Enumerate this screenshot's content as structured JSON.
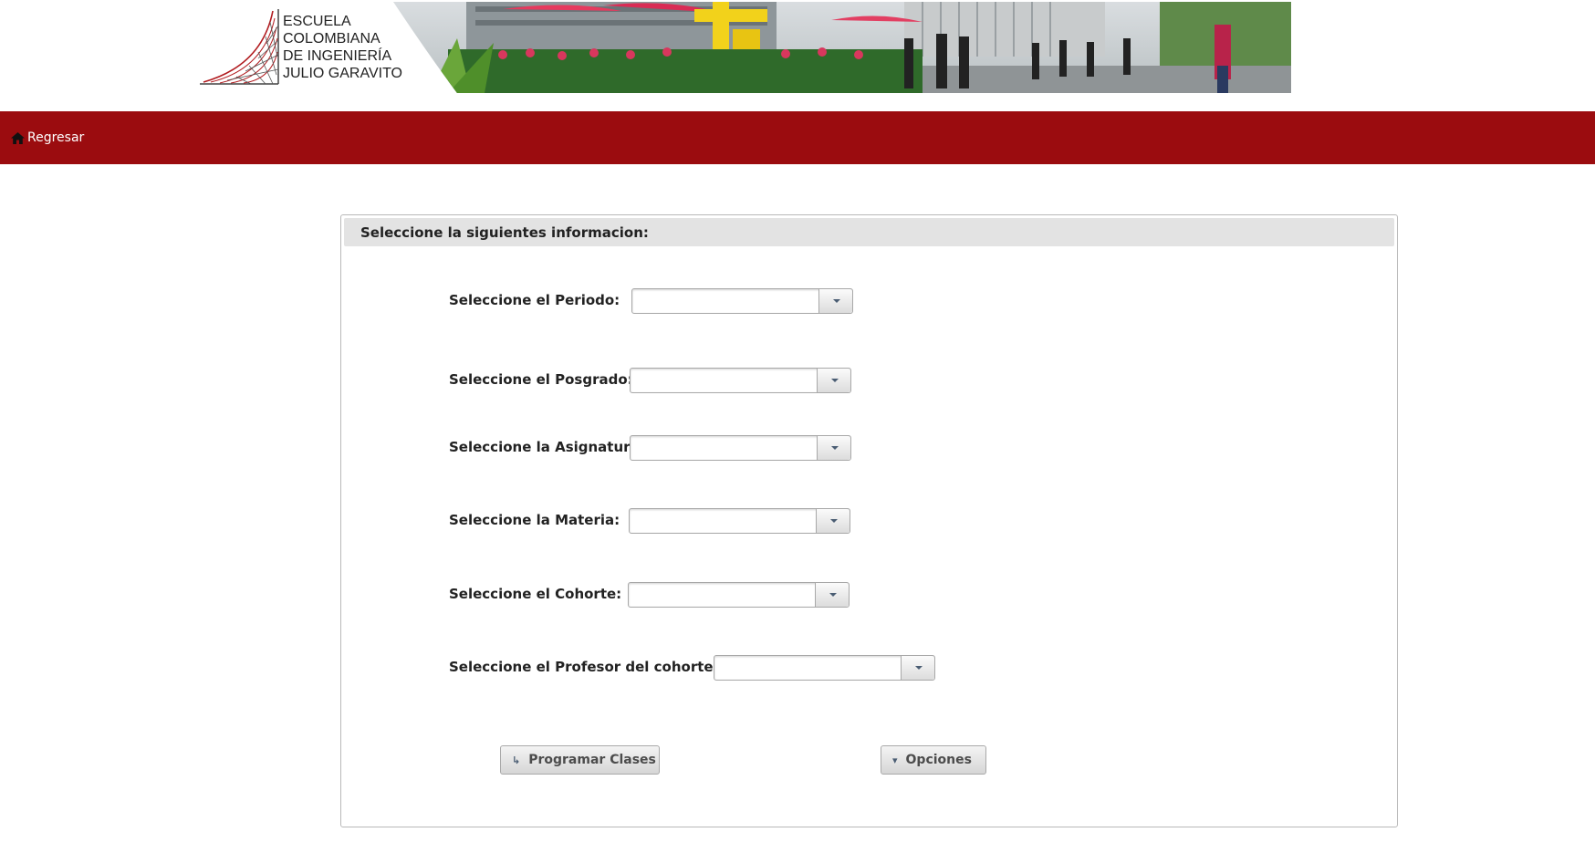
{
  "header": {
    "logo_lines": [
      "ESCUELA",
      "COLOMBIANA",
      "DE INGENIERÍA",
      "JULIO GARAVITO"
    ]
  },
  "nav": {
    "back_label": "Regresar",
    "back_icon": "home-icon",
    "bar_color": "#9b0c0f"
  },
  "form": {
    "title": "Seleccione la siguientes informacion:",
    "fields": [
      {
        "label": "Seleccione el Periodo:",
        "value": ""
      },
      {
        "label": "Seleccione el Posgrado:",
        "value": ""
      },
      {
        "label": "Seleccione la Asignatura:",
        "value": ""
      },
      {
        "label": "Seleccione la Materia:",
        "value": ""
      },
      {
        "label": "Seleccione el Cohorte:",
        "value": ""
      },
      {
        "label": "Seleccione el Profesor del cohorte:",
        "value": ""
      }
    ],
    "buttons": {
      "programar_label": "Programar Clases",
      "programar_icon": "return-arrow-icon",
      "opciones_label": "Opciones",
      "opciones_icon": "caret-down-icon"
    }
  }
}
